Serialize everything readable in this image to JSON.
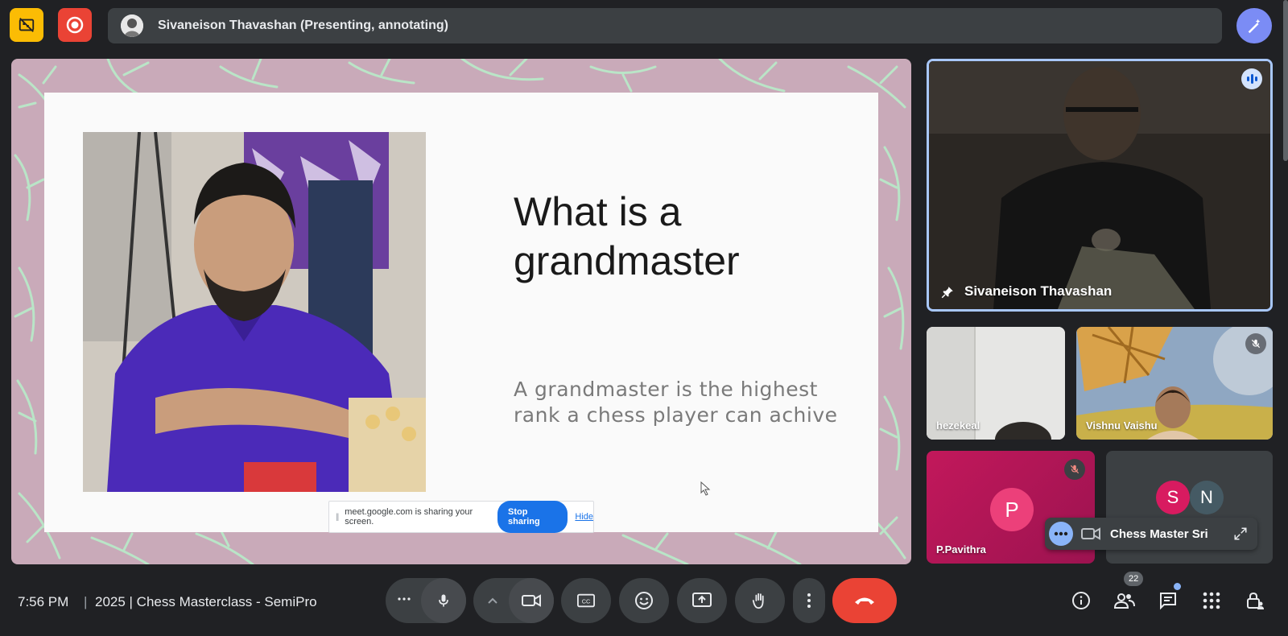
{
  "top_bar": {
    "presenter_label": "Sivaneison Thavashan (Presenting, annotating)",
    "icons": {
      "left": "no-video-feed-icon",
      "recording": "recording-icon",
      "right": "ai-pen-icon"
    }
  },
  "slide": {
    "title": "What is a\ngrandmaster",
    "body": "A grandmaster is the highest\nrank a chess player can achive",
    "background_color": "#c9aab9",
    "leaf_color": "#b8ecc9"
  },
  "share_notice": {
    "text": "meet.google.com is sharing your screen.",
    "stop_label": "Stop sharing",
    "hide_label": "Hide"
  },
  "participants": {
    "main": {
      "name": "Sivaneison Thavashan",
      "pinned": true,
      "speaking": true
    },
    "tile2": {
      "name": "hezekeal"
    },
    "tile3": {
      "name": "Vishnu Vaishu",
      "muted": true
    },
    "tile4": {
      "name": "P.Pavithra",
      "initial": "P",
      "muted": true
    },
    "tile5": {
      "avatars": [
        {
          "initial": "S",
          "color": "#d81b60"
        },
        {
          "initial": "N",
          "color": "#455a64"
        }
      ]
    }
  },
  "floating": {
    "name": "Chess Master Sri"
  },
  "bottom_bar": {
    "time": "7:56 PM",
    "separator": "|",
    "meeting_title": "2025 | Chess Masterclass - SemiPro",
    "people_count": "22"
  },
  "colors": {
    "accent": "#8ab4f8",
    "end_call": "#ea4335",
    "stop_sharing": "#1a73e8",
    "active_tile_border": "#a8c7fa"
  }
}
